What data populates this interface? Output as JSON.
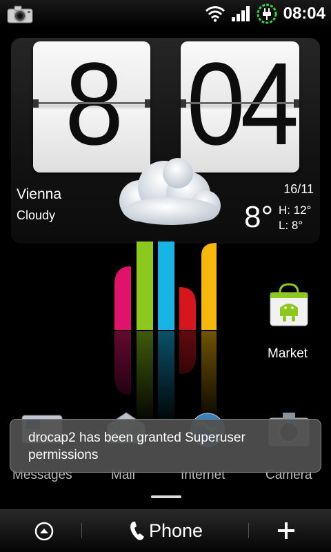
{
  "status_bar": {
    "time": "08:04",
    "icons": [
      "camera-icon",
      "wifi-icon",
      "signal-icon",
      "battery-charging-icon"
    ]
  },
  "clock": {
    "hour": "8",
    "minute": "04"
  },
  "weather": {
    "city": "Vienna",
    "condition": "Cloudy",
    "date": "16/11",
    "temperature": "8°",
    "high": "H: 12°",
    "low": "L:   8°",
    "icon": "cloud-icon"
  },
  "shortcuts": [
    {
      "label": "Market",
      "icon": "market-bag-icon"
    }
  ],
  "dock": [
    {
      "label": "Messages",
      "icon": "messages-icon"
    },
    {
      "label": "Mail",
      "icon": "mail-icon"
    },
    {
      "label": "Internet",
      "icon": "globe-icon"
    },
    {
      "label": "Camera",
      "icon": "camera-icon"
    }
  ],
  "toast": {
    "message": "drocap2 has been granted Superuser permissions"
  },
  "bottom_bar": {
    "phone_label": "Phone",
    "icons": [
      "all-apps-icon",
      "phone-handset-icon",
      "add-icon"
    ]
  },
  "colors": {
    "bar_pink": "#e0136b",
    "bar_green": "#8cc81e",
    "bar_cyan": "#18b4e6",
    "bar_red": "#d5171d",
    "bar_yellow": "#f7b80c",
    "battery_ring": "#3fcf3f"
  }
}
